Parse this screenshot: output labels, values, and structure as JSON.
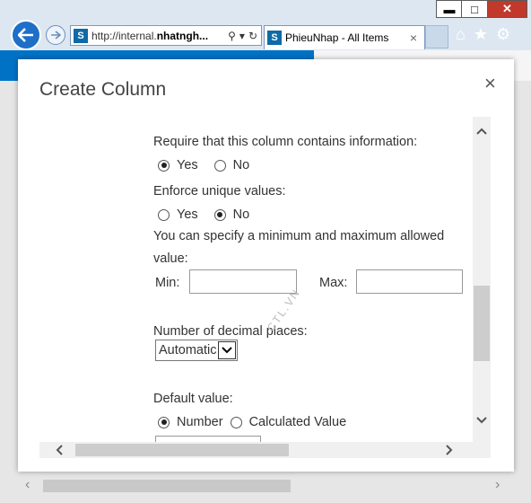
{
  "browser": {
    "url_prefix": "http://internal.",
    "url_domain": "nhatngh...",
    "tab_title": "PhieuNhap - All Items",
    "tab_close": "×",
    "minimize": "▬",
    "maximize": "□",
    "close": "✕"
  },
  "dialog": {
    "title": "Create Column",
    "close": "×",
    "required_label": "Require that this column contains information:",
    "required_options": [
      "Yes",
      "No"
    ],
    "required_selected": "Yes",
    "unique_label": "Enforce unique values:",
    "unique_options": [
      "Yes",
      "No"
    ],
    "unique_selected": "No",
    "minmax_line1": "You can specify a minimum and maximum allowed",
    "minmax_line2": "value:",
    "min_label": "Min:",
    "min_value": "",
    "max_label": "Max:",
    "max_value": "",
    "decimal_label": "Number of decimal places:",
    "decimal_value": "Automatic",
    "default_label": "Default value:",
    "default_options": [
      "Number",
      "Calculated Value"
    ],
    "default_selected": "Number",
    "default_value": "",
    "watermark": "CTL.VN"
  },
  "colors": {
    "chrome": "#dde7f2",
    "back_button": "#1e6fc8",
    "sharepoint_band": "#0072c6",
    "close_button": "#c0392b"
  }
}
